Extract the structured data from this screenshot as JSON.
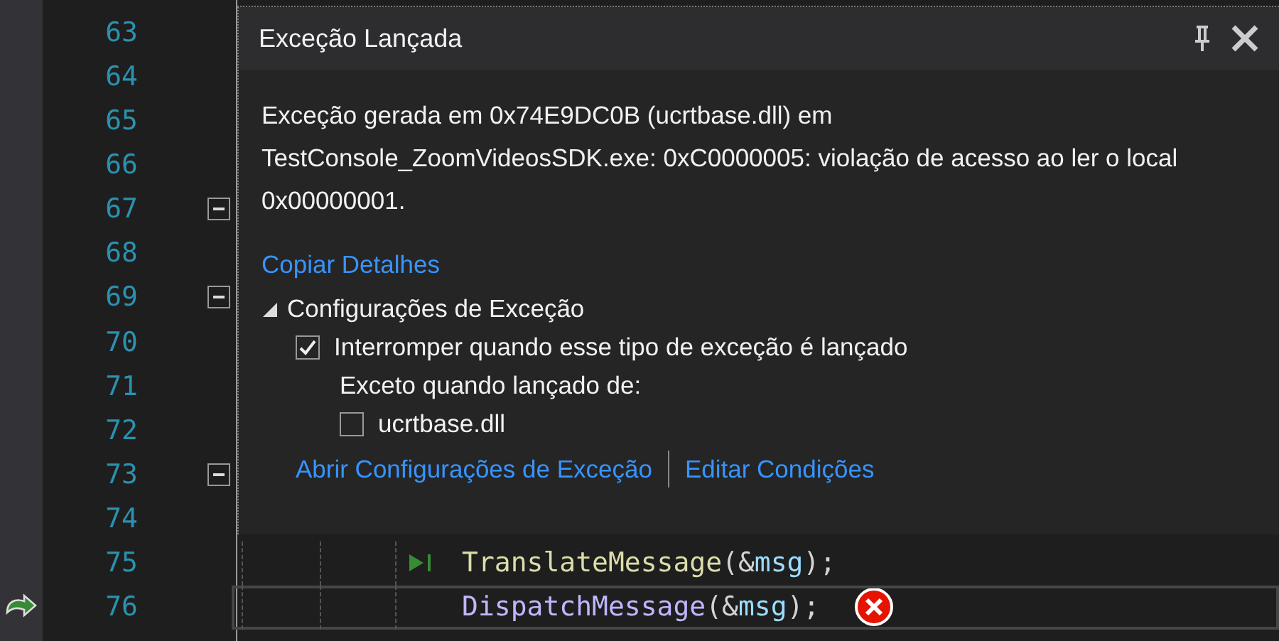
{
  "editor": {
    "lines": [
      {
        "number": "63",
        "fold_marker": false
      },
      {
        "number": "64",
        "fold_marker": false
      },
      {
        "number": "65",
        "fold_marker": false
      },
      {
        "number": "66",
        "fold_marker": false
      },
      {
        "number": "67",
        "fold_marker": true
      },
      {
        "number": "68",
        "fold_marker": false
      },
      {
        "number": "69",
        "fold_marker": true
      },
      {
        "number": "70",
        "fold_marker": false
      },
      {
        "number": "71",
        "fold_marker": false
      },
      {
        "number": "72",
        "fold_marker": false
      },
      {
        "number": "73",
        "fold_marker": true
      },
      {
        "number": "74",
        "fold_marker": false
      },
      {
        "number": "75",
        "fold_marker": false,
        "run_to_click": true,
        "current": false,
        "error": false,
        "tokens": [
          {
            "kind": "function",
            "text": "TranslateMessage"
          },
          {
            "kind": "punct",
            "text": "(&"
          },
          {
            "kind": "param",
            "text": "msg"
          },
          {
            "kind": "punct",
            "text": ");"
          }
        ]
      },
      {
        "number": "76",
        "fold_marker": false,
        "run_to_click": false,
        "current": true,
        "error": true,
        "tokens": [
          {
            "kind": "macro",
            "text": "DispatchMessage"
          },
          {
            "kind": "punct",
            "text": "(&"
          },
          {
            "kind": "param",
            "text": "msg"
          },
          {
            "kind": "punct",
            "text": ");"
          }
        ]
      }
    ]
  },
  "exception_popup": {
    "title": "Exceção Lançada",
    "message": "Exceção gerada em 0x74E9DC0B (ucrtbase.dll) em TestConsole_ZoomVideosSDK.exe: 0xC0000005: violação de acesso ao ler o local 0x00000001.",
    "copy_link": "Copiar Detalhes",
    "settings": {
      "label": "Configurações de Exceção",
      "expanded": true,
      "break_option": {
        "label": "Interromper quando esse tipo de exceção é lançado",
        "checked": true
      },
      "except_label": "Exceto quando lançado de:",
      "modules": [
        {
          "label": "ucrtbase.dll",
          "checked": false
        }
      ]
    },
    "links": [
      "Abrir Configurações de Exceção",
      "Editar Condições"
    ]
  }
}
